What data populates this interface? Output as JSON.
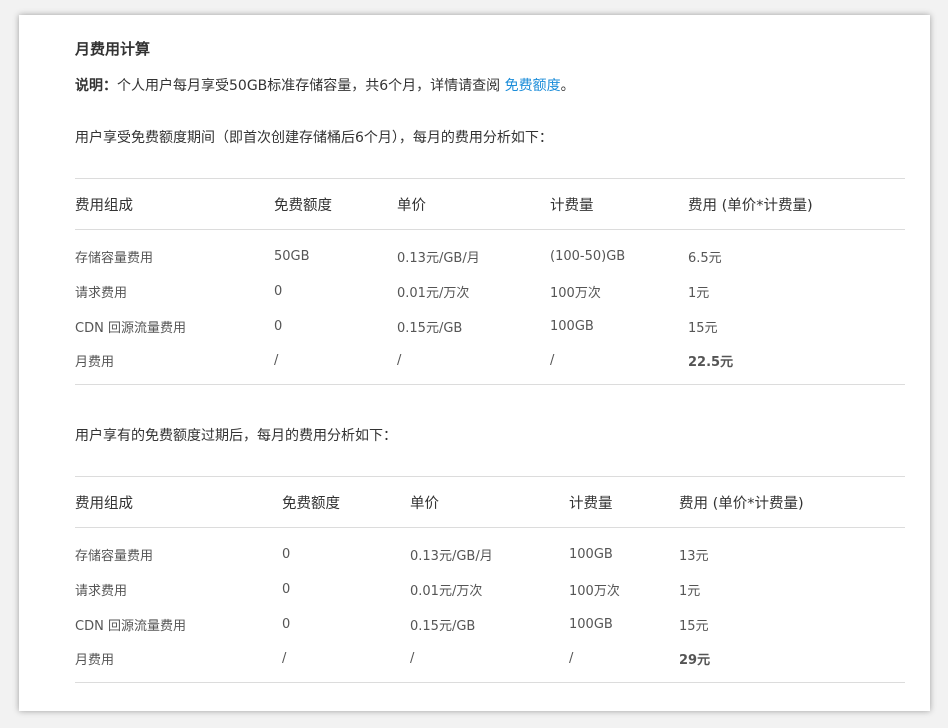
{
  "heading": "月费用计算",
  "note": {
    "label": "说明：",
    "text": "个人用户每月享受50GB标准存储容量，共6个月，详情请查阅",
    "link": "免费额度",
    "end": "。"
  },
  "section1": {
    "intro": "用户享受免费额度期间（即首次创建存储桶后6个月），每月的费用分析如下：",
    "headers": [
      "费用组成",
      "免费额度",
      "单价",
      "计费量",
      "费用 (单价*计费量)"
    ],
    "rows": [
      [
        "存储容量费用",
        "50GB",
        "0.13元/GB/月",
        "(100-50)GB",
        "6.5元"
      ],
      [
        "请求费用",
        "0",
        "0.01元/万次",
        "100万次",
        "1元"
      ],
      [
        "CDN 回源流量费用",
        "0",
        "0.15元/GB",
        "100GB",
        "15元"
      ],
      [
        "月费用",
        "/",
        "/",
        "/",
        "22.5元"
      ]
    ]
  },
  "section2": {
    "intro": "用户享有的免费额度过期后，每月的费用分析如下：",
    "headers": [
      "费用组成",
      "免费额度",
      "单价",
      "计费量",
      "费用 (单价*计费量)"
    ],
    "rows": [
      [
        "存储容量费用",
        "0",
        "0.13元/GB/月",
        "100GB",
        "13元"
      ],
      [
        "请求费用",
        "0",
        "0.01元/万次",
        "100万次",
        "1元"
      ],
      [
        "CDN 回源流量费用",
        "0",
        "0.15元/GB",
        "100GB",
        "15元"
      ],
      [
        "月费用",
        "/",
        "/",
        "/",
        "29元"
      ]
    ]
  },
  "colors": {
    "link": "#1c8dd9",
    "text": "#333333",
    "border": "#dcdcdc"
  }
}
